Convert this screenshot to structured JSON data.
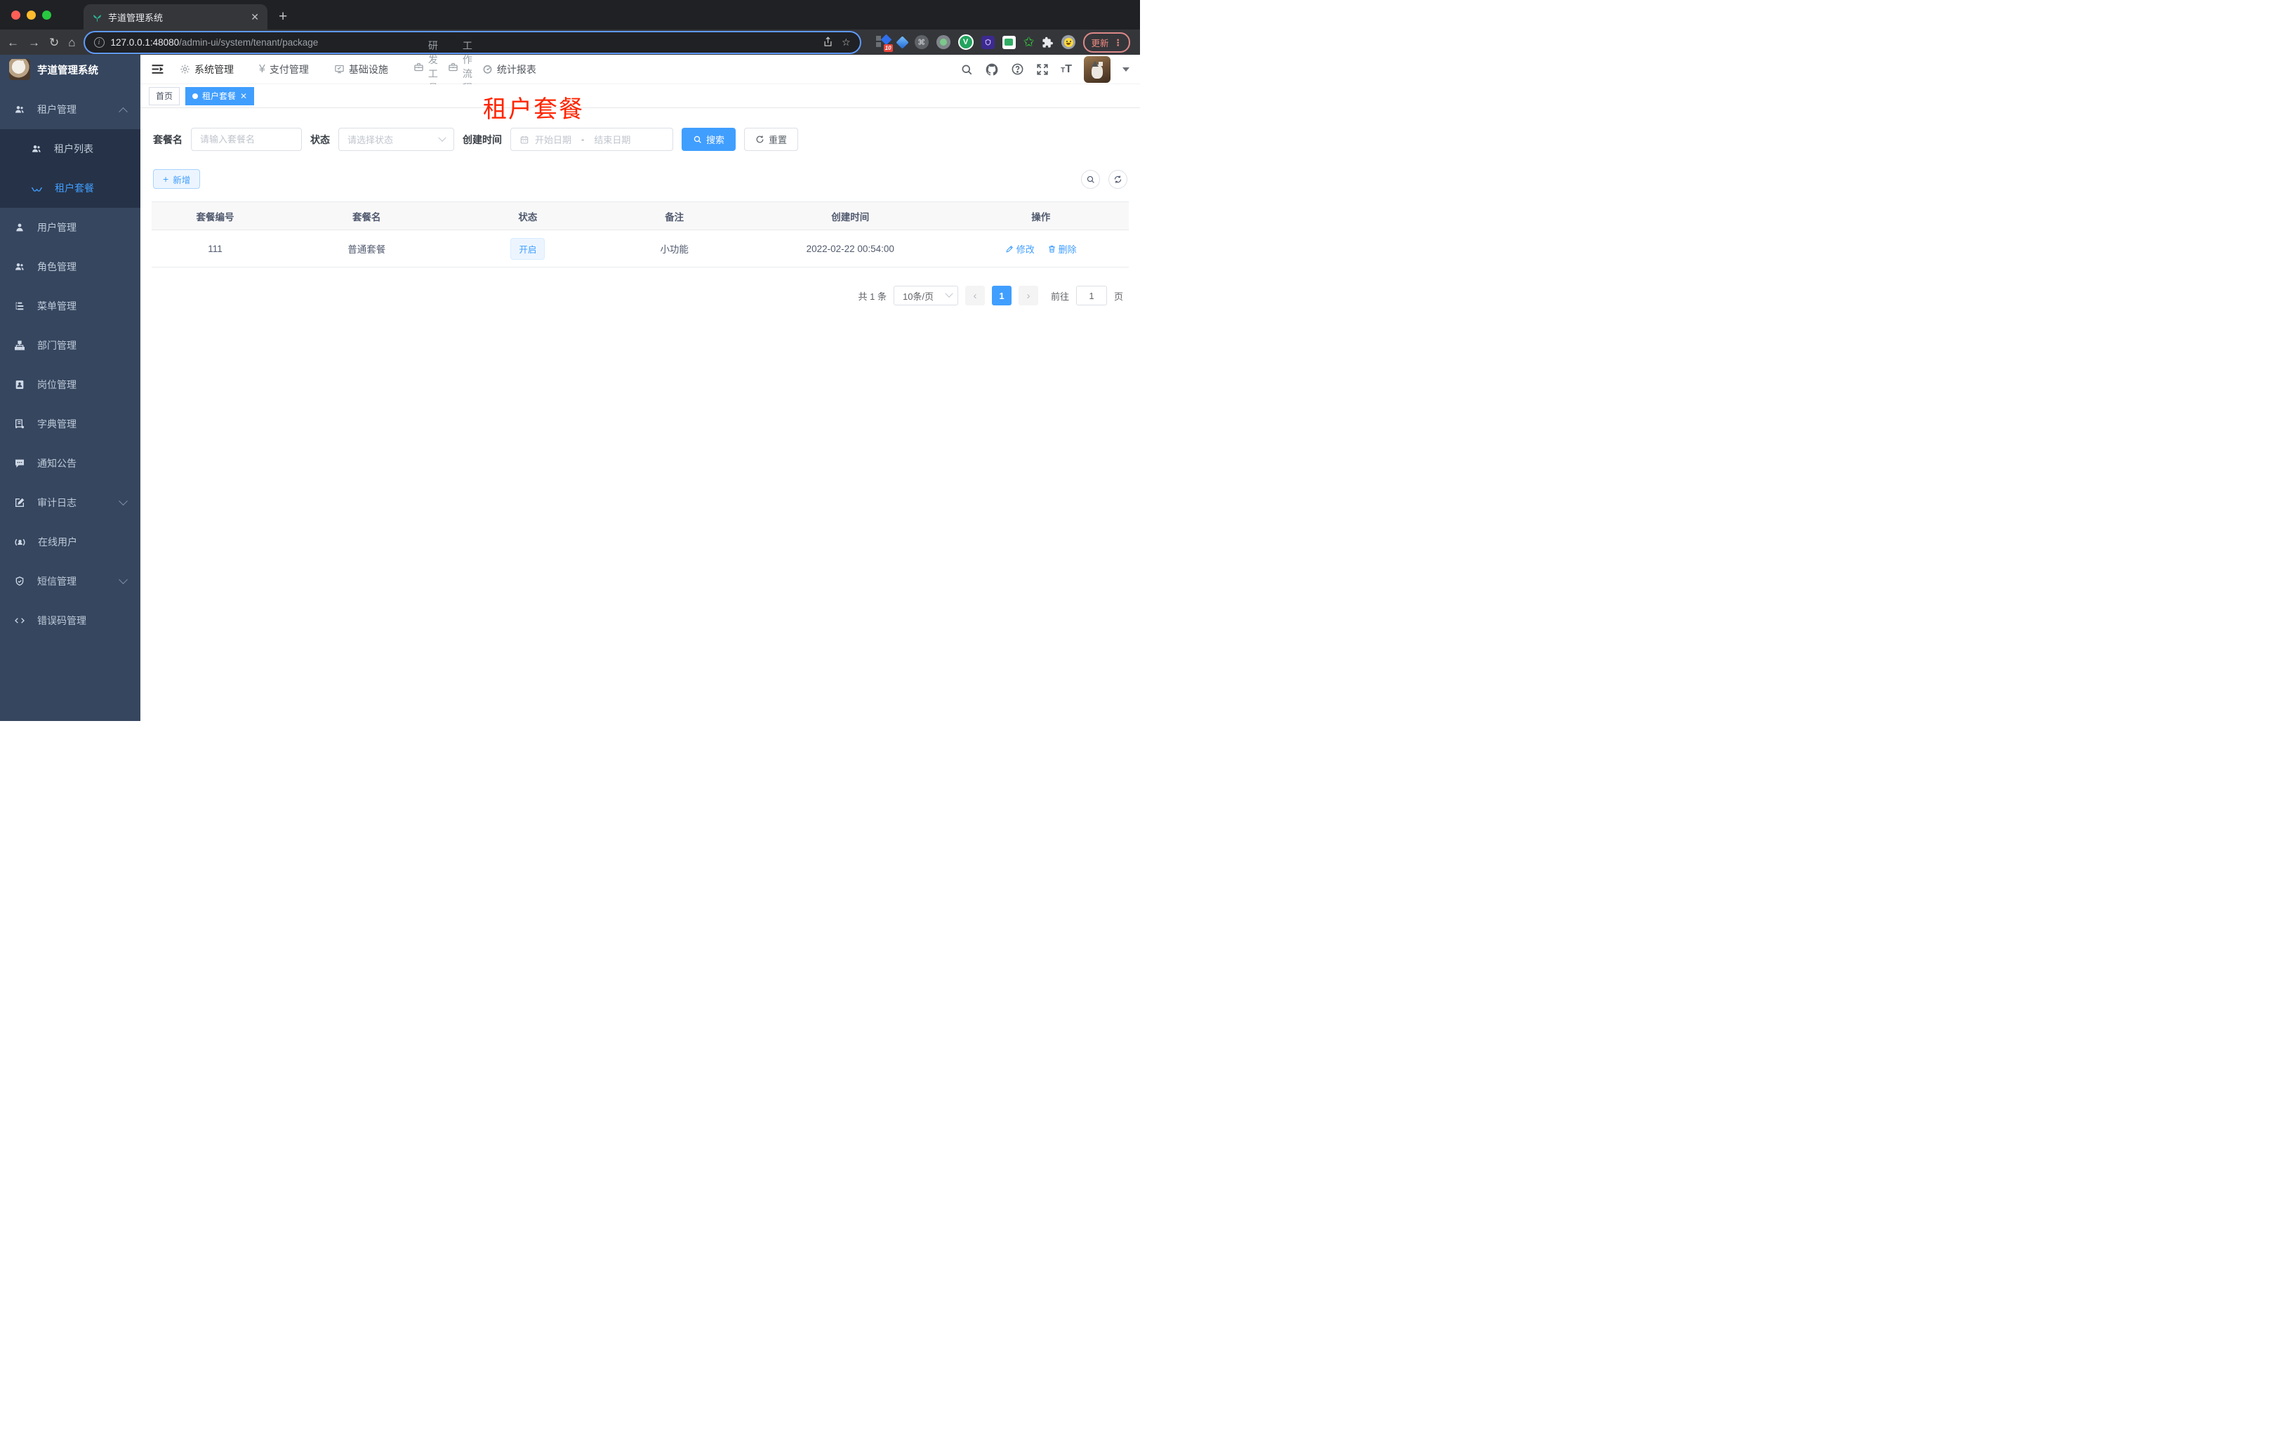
{
  "browser": {
    "tab_title": "芋道管理系统",
    "url_host": "127.0.0.1:48080",
    "url_path": "/admin-ui/system/tenant/package",
    "update_label": "更新",
    "extension_badge": "10",
    "extension_v": "V"
  },
  "header": {
    "nav": [
      {
        "label": "系统管理"
      },
      {
        "label": "支付管理"
      },
      {
        "label": "基础设施"
      },
      {
        "label": "研发工具"
      },
      {
        "label": "工作流程"
      },
      {
        "label": "统计报表"
      }
    ]
  },
  "sidebar": {
    "title": "芋道管理系统",
    "items": [
      {
        "label": "租户管理"
      },
      {
        "label": "租户列表"
      },
      {
        "label": "租户套餐"
      },
      {
        "label": "用户管理"
      },
      {
        "label": "角色管理"
      },
      {
        "label": "菜单管理"
      },
      {
        "label": "部门管理"
      },
      {
        "label": "岗位管理"
      },
      {
        "label": "字典管理"
      },
      {
        "label": "通知公告"
      },
      {
        "label": "审计日志"
      },
      {
        "label": "在线用户"
      },
      {
        "label": "短信管理"
      },
      {
        "label": "错误码管理"
      }
    ]
  },
  "tags": {
    "home": "首页",
    "active": "租户套餐"
  },
  "overlay": {
    "title": "租户套餐"
  },
  "filters": {
    "name_label": "套餐名",
    "name_placeholder": "请输入套餐名",
    "status_label": "状态",
    "status_placeholder": "请选择状态",
    "date_label": "创建时间",
    "date_start": "开始日期",
    "date_separator": "-",
    "date_end": "结束日期",
    "search_label": "搜索",
    "reset_label": "重置"
  },
  "toolbar": {
    "add_label": "新增"
  },
  "table": {
    "headers": [
      "套餐编号",
      "套餐名",
      "状态",
      "备注",
      "创建时间",
      "操作"
    ],
    "rows": [
      {
        "id": "111",
        "name": "普通套餐",
        "status": "开启",
        "remark": "小功能",
        "created_at": "2022-02-22 00:54:00",
        "edit_label": "修改",
        "delete_label": "删除"
      }
    ]
  },
  "pagination": {
    "total": "共 1 条",
    "page_size": "10条/页",
    "current_page": "1",
    "goto_label": "前往",
    "goto_value": "1",
    "unit_label": "页"
  },
  "colors": {
    "primary": "#409eff",
    "sidebar_bg": "#36465f",
    "submenu_bg": "#263247",
    "overlay_red": "#ff2400",
    "status_tag_bg": "#ecf5ff",
    "table_header_bg": "#f8f8f9"
  }
}
